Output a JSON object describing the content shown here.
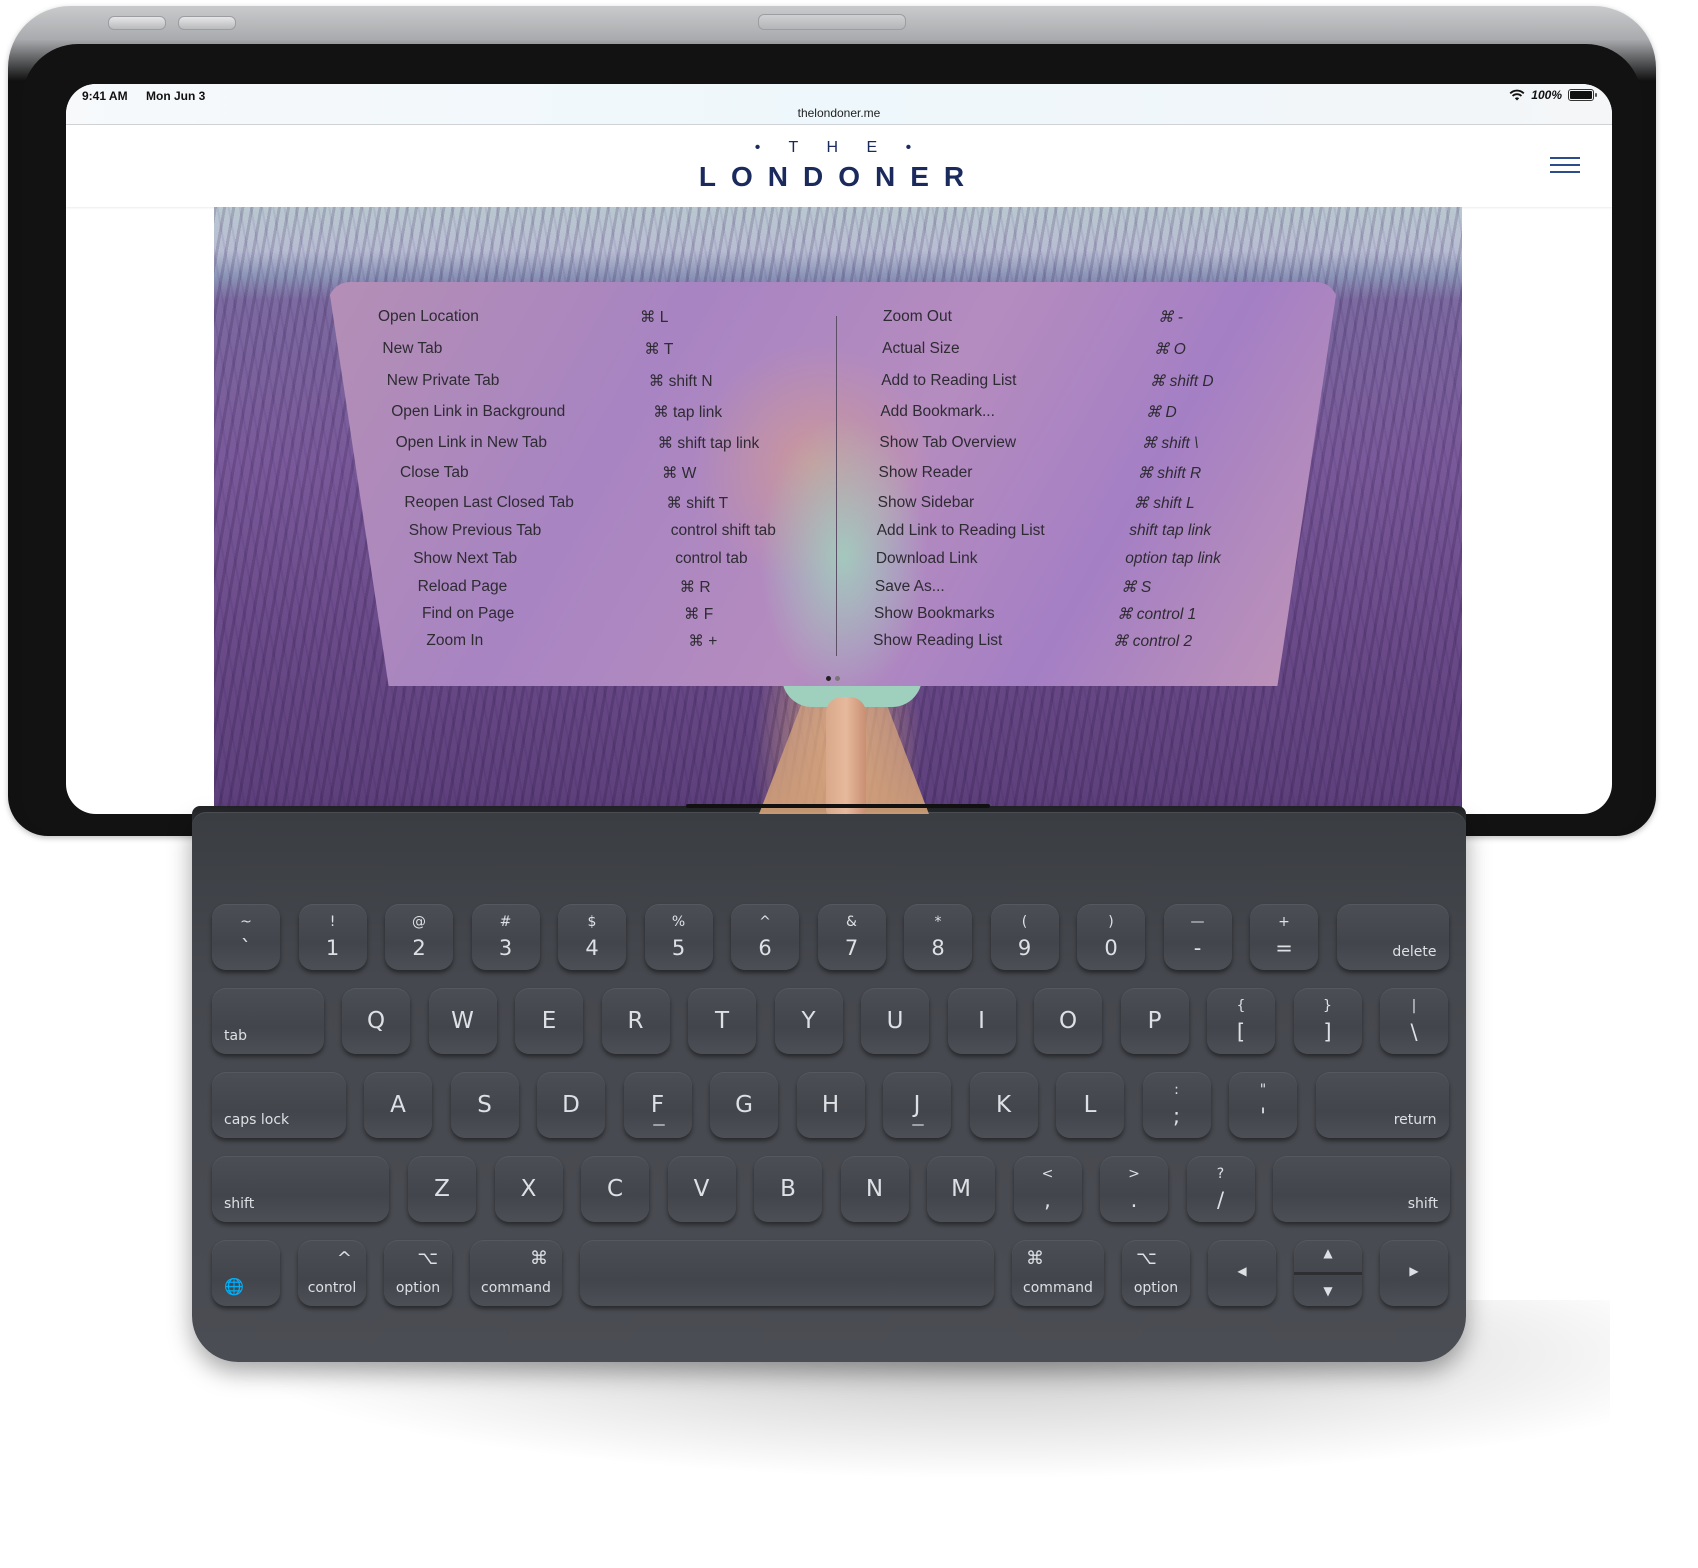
{
  "status_bar": {
    "time": "9:41 AM",
    "date": "Mon Jun 3",
    "battery_percent": "100%",
    "wifi_icon": "wifi-icon",
    "battery_icon": "battery-icon"
  },
  "browser": {
    "url": "thelondoner.me"
  },
  "site": {
    "logo_top": "• T H E •",
    "logo_main": "LONDONER",
    "menu_icon": "hamburger-menu-icon"
  },
  "shortcuts": {
    "left": [
      {
        "label": "Open Location",
        "keys": "⌘ L"
      },
      {
        "label": "New Tab",
        "keys": "⌘ T"
      },
      {
        "label": "New Private Tab",
        "keys": "⌘ shift N"
      },
      {
        "label": "Open Link in Background",
        "keys": "⌘ tap link"
      },
      {
        "label": "Open Link in New Tab",
        "keys": "⌘ shift tap link"
      },
      {
        "label": "Close Tab",
        "keys": "⌘ W"
      },
      {
        "label": "Reopen Last Closed Tab",
        "keys": "⌘ shift T"
      },
      {
        "label": "Show Previous Tab",
        "keys": "control shift tab"
      },
      {
        "label": "Show Next Tab",
        "keys": "control tab"
      },
      {
        "label": "Reload Page",
        "keys": "⌘ R"
      },
      {
        "label": "Find on Page",
        "keys": "⌘ F"
      },
      {
        "label": "Zoom In",
        "keys": "⌘ +"
      }
    ],
    "right": [
      {
        "label": "Zoom Out",
        "keys": "⌘ -"
      },
      {
        "label": "Actual Size",
        "keys": "⌘ O"
      },
      {
        "label": "Add to Reading List",
        "keys": "⌘ shift D"
      },
      {
        "label": "Add Bookmark...",
        "keys": "⌘ D"
      },
      {
        "label": "Show Tab Overview",
        "keys": "⌘ shift \\"
      },
      {
        "label": "Show Reader",
        "keys": "⌘ shift R"
      },
      {
        "label": "Show Sidebar",
        "keys": "⌘ shift L"
      },
      {
        "label": "Add Link to Reading List",
        "keys": "shift tap link"
      },
      {
        "label": "Download Link",
        "keys": "option tap link"
      },
      {
        "label": "Save As...",
        "keys": "⌘ S"
      },
      {
        "label": "Show Bookmarks",
        "keys": "⌘ control 1"
      },
      {
        "label": "Show Reading List",
        "keys": "⌘ control 2"
      }
    ],
    "page_count": 2,
    "current_page": 1
  },
  "keyboard": {
    "row1": [
      {
        "top": "~",
        "bot": "`"
      },
      {
        "top": "!",
        "bot": "1"
      },
      {
        "top": "@",
        "bot": "2"
      },
      {
        "top": "#",
        "bot": "3"
      },
      {
        "top": "$",
        "bot": "4"
      },
      {
        "top": "%",
        "bot": "5"
      },
      {
        "top": "^",
        "bot": "6"
      },
      {
        "top": "&",
        "bot": "7"
      },
      {
        "top": "*",
        "bot": "8"
      },
      {
        "top": "(",
        "bot": "9"
      },
      {
        "top": ")",
        "bot": "0"
      },
      {
        "top": "—",
        "bot": "-"
      },
      {
        "top": "+",
        "bot": "="
      }
    ],
    "delete": "delete",
    "tab": "tab",
    "row2": [
      "Q",
      "W",
      "E",
      "R",
      "T",
      "Y",
      "U",
      "I",
      "O",
      "P"
    ],
    "row2_sym": [
      {
        "top": "{",
        "bot": "["
      },
      {
        "top": "}",
        "bot": "]"
      },
      {
        "top": "|",
        "bot": "\\"
      }
    ],
    "caps_lock": "caps lock",
    "row3": [
      "A",
      "S",
      "D",
      "F",
      "G",
      "H",
      "J",
      "K",
      "L"
    ],
    "row3_sym": [
      {
        "top": ":",
        "bot": ";"
      },
      {
        "top": "\"",
        "bot": "'"
      }
    ],
    "return": "return",
    "shift": "shift",
    "row4": [
      "Z",
      "X",
      "C",
      "V",
      "B",
      "N",
      "M"
    ],
    "row4_sym": [
      {
        "top": "<",
        "bot": ","
      },
      {
        "top": ">",
        "bot": "."
      },
      {
        "top": "?",
        "bot": "/"
      }
    ],
    "globe": "🌐",
    "control": "control",
    "control_sym": "^",
    "option": "option",
    "option_sym": "⌥",
    "command": "command",
    "command_sym": "⌘",
    "arrow_left": "◀",
    "arrow_up": "▲",
    "arrow_down": "▼",
    "arrow_right": "▶"
  },
  "colors": {
    "brand_navy": "#1b2a5c",
    "menu_icon": "#2d4d8a",
    "key_face": "#46494f",
    "key_legend": "#dde0e4"
  }
}
